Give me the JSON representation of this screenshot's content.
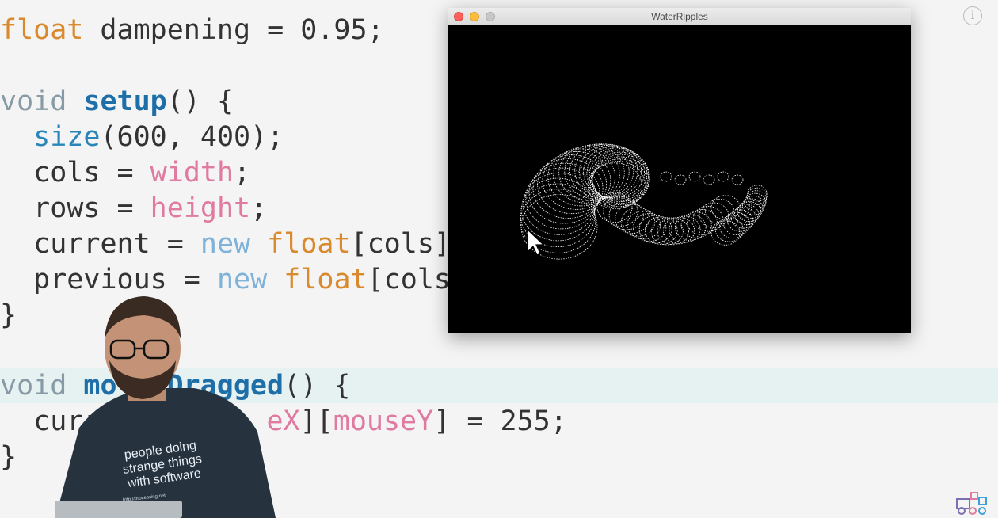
{
  "code": {
    "line1": {
      "type": "float",
      "rest": " dampening = 0.95;"
    },
    "line3": {
      "kw": "void",
      "fn": "setup",
      "rest": "() {"
    },
    "line4": {
      "fn": "size",
      "rest": "(600, 400);"
    },
    "line5": {
      "lhs": "cols = ",
      "var": "width",
      "rest": ";"
    },
    "line6": {
      "lhs": "rows = ",
      "var": "height",
      "rest": ";"
    },
    "line7": {
      "lhs": "current = ",
      "new": "new",
      "type": "float",
      "rest": "[cols]"
    },
    "line8": {
      "lhs": "previous = ",
      "new": "new",
      "type": "float",
      "rest": "[cols"
    },
    "line9": "}",
    "line11": {
      "kw": "void",
      "fn_a": "mo",
      "fn_b": "Dragged",
      "rest": "() {"
    },
    "line12": {
      "lhs": "curr",
      "var_a": "eX",
      "mid": "][",
      "var_b": "mouseY",
      "rest": "] = 255;"
    },
    "line13": "}"
  },
  "sketch_window": {
    "title": "WaterRipples"
  },
  "presenter_shirt": {
    "line1": "people doing",
    "line2": "strange things",
    "line3": "with software",
    "url": "http://processing.net"
  },
  "colors": {
    "close": "#fc605c",
    "minimize": "#fdbc40",
    "zoom": "#c7c7c7",
    "highlight_band": "#e6f1f2"
  },
  "icons": [
    "info-icon",
    "coding-train-logo-icon",
    "mouse-cursor-icon"
  ]
}
